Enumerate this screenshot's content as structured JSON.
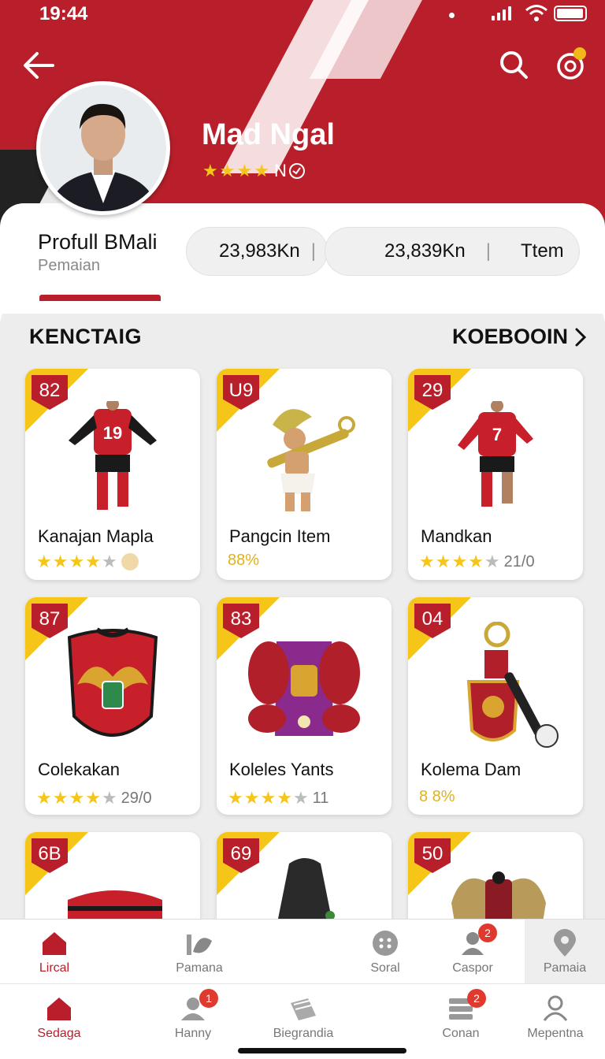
{
  "status_bar": {
    "time": "19:44"
  },
  "profile": {
    "name": "Mad Ngal",
    "rating_suffix": "N",
    "section_title": "Profull BMali",
    "section_subtitle": "Pemaian",
    "stats": [
      {
        "value": "23,983Kn"
      },
      {
        "value": "23,839Kn"
      }
    ],
    "stat_tab_label": "Ttem"
  },
  "collection": {
    "title": "KENCTAIG",
    "link_label": "KOEBOOIN"
  },
  "cards": [
    {
      "rank": "82",
      "title": "Kanajan Mapla",
      "stars": 4,
      "extra": "",
      "art": "player-red",
      "kit_number": "19"
    },
    {
      "rank": "U9",
      "title": "Pangcin Item",
      "stars": 0,
      "percent": "88%",
      "extra": "",
      "art": "warrior"
    },
    {
      "rank": "29",
      "title": "Mandkan",
      "stars": 4,
      "extra": "21/0",
      "art": "player-red",
      "kit_number": "7"
    },
    {
      "rank": "87",
      "title": "Colekakan",
      "stars": 4,
      "extra": "29/0",
      "art": "jersey-crest"
    },
    {
      "rank": "83",
      "title": "Koleles Yants",
      "stars": 4,
      "extra": "11",
      "art": "jersey-purple"
    },
    {
      "rank": "04",
      "title": "Kolema Dam",
      "stars": 0,
      "percent": "8 8%",
      "extra": "",
      "art": "keychain"
    },
    {
      "rank": "6B",
      "title": "",
      "art": "jersey-partial"
    },
    {
      "rank": "69",
      "title": "",
      "art": "jacket-partial"
    },
    {
      "rank": "50",
      "title": "",
      "art": "eagle-partial"
    }
  ],
  "nav_top": [
    {
      "label": "Lircal",
      "icon": "home-icon",
      "active": true
    },
    {
      "label": "Pamana",
      "icon": "chart-icon"
    },
    {
      "label": "Soral",
      "icon": "dots-icon"
    },
    {
      "label": "Caspor",
      "icon": "user-icon",
      "badge": "2"
    },
    {
      "label": "Pamaia",
      "icon": "location-pin-icon"
    }
  ],
  "nav_bottom": [
    {
      "label": "Sedaga",
      "icon": "home-icon",
      "active": true
    },
    {
      "label": "Hanny",
      "icon": "user-icon",
      "badge": "1"
    },
    {
      "label": "Biegrandia",
      "icon": "book-icon"
    },
    {
      "label": "Conan",
      "icon": "stack-icon",
      "badge": "2"
    },
    {
      "label": "Mepentna",
      "icon": "person-icon"
    }
  ],
  "colors": {
    "primary": "#b81f2a",
    "accent": "#f5c518"
  }
}
